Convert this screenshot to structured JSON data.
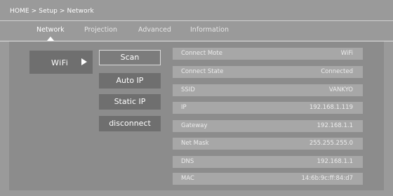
{
  "breadcrumb": "HOME > Setup > Network",
  "tabs": [
    {
      "label": "Network"
    },
    {
      "label": "Projection"
    },
    {
      "label": "Advanced"
    },
    {
      "label": "Information"
    }
  ],
  "left_menu": {
    "wifi_label": "WiFi"
  },
  "actions": {
    "scan": "Scan",
    "auto_ip": "Auto IP",
    "static_ip": "Static IP",
    "disconnect": "disconnect"
  },
  "info_rows": [
    {
      "key": "Connect Mote",
      "value": "WiFi"
    },
    {
      "key": "Connect State",
      "value": "Connected"
    },
    {
      "key": "SSID",
      "value": "VANKYO"
    },
    {
      "key": "IP",
      "value": "192.168.1.119"
    },
    {
      "key": "Gateway",
      "value": "192.168.1.1"
    },
    {
      "key": "Net Mask",
      "value": "255.255.255.0"
    },
    {
      "key": "DNS",
      "value": "192.168.1.1"
    },
    {
      "key": "MAC",
      "value": "14:6b:9c:ff:84:d7"
    }
  ],
  "colors": {
    "background": "#9a9a9a",
    "panel": "#8c8c8c",
    "button": "#6f6f6f",
    "info_row": "#a7a7a7",
    "text": "#ffffff"
  }
}
